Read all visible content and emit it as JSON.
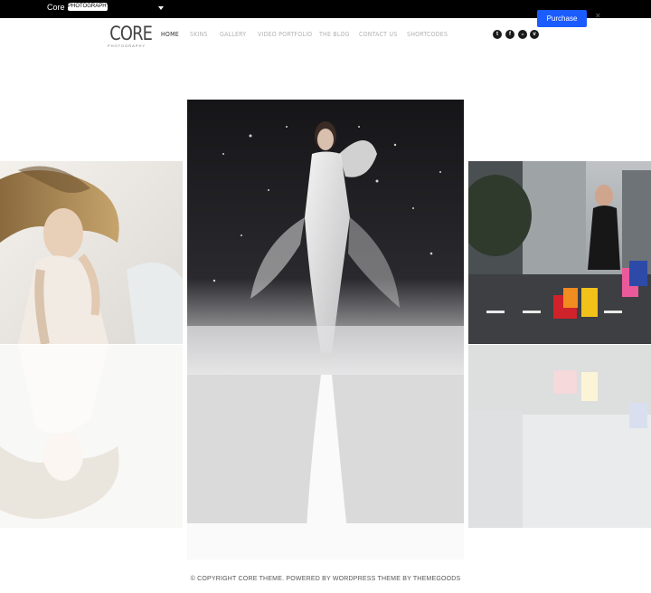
{
  "topbar": {
    "brand": "Core",
    "skin_selected": "PHOTOGRAPHY",
    "purchase_label": "Purchase",
    "close_label": "✕"
  },
  "logo": {
    "main": "CORE",
    "sub": "PHOTOGRAPHY"
  },
  "nav": {
    "items": [
      {
        "label": "HOME"
      },
      {
        "label": "SKINS"
      },
      {
        "label": "GALLERY"
      },
      {
        "label": "VIDEO PORTFOLIO"
      },
      {
        "label": "THE BLOG"
      },
      {
        "label": "CONTACT US"
      },
      {
        "label": "SHORTCODES"
      }
    ]
  },
  "social": [
    {
      "icon": "twitter-icon",
      "glyph": "t"
    },
    {
      "icon": "facebook-icon",
      "glyph": "f"
    },
    {
      "icon": "flickr-icon",
      "glyph": "••"
    },
    {
      "icon": "vimeo-icon",
      "glyph": "v"
    }
  ],
  "footer": {
    "text": "© COPYRIGHT CORE THEME. POWERED BY WORDPRESS THEME BY THEMEGOODS"
  },
  "colors": {
    "purchase": "#1a5cff",
    "topbar": "#000000",
    "nav_active": "#333333",
    "nav_inactive": "#b3b3b3"
  }
}
